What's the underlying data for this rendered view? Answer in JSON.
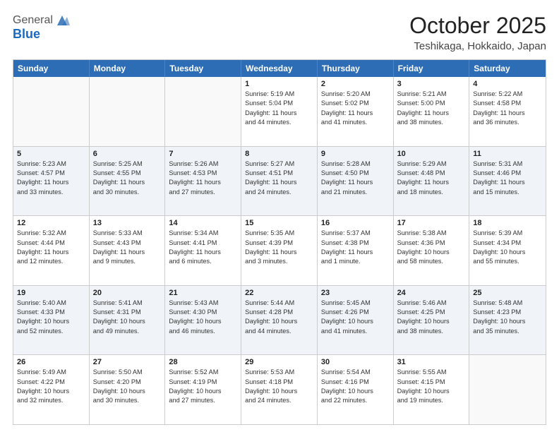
{
  "header": {
    "logo_general": "General",
    "logo_blue": "Blue",
    "month_title": "October 2025",
    "location": "Teshikaga, Hokkaido, Japan"
  },
  "weekdays": [
    "Sunday",
    "Monday",
    "Tuesday",
    "Wednesday",
    "Thursday",
    "Friday",
    "Saturday"
  ],
  "rows": [
    [
      {
        "day": "",
        "info": ""
      },
      {
        "day": "",
        "info": ""
      },
      {
        "day": "",
        "info": ""
      },
      {
        "day": "1",
        "info": "Sunrise: 5:19 AM\nSunset: 5:04 PM\nDaylight: 11 hours\nand 44 minutes."
      },
      {
        "day": "2",
        "info": "Sunrise: 5:20 AM\nSunset: 5:02 PM\nDaylight: 11 hours\nand 41 minutes."
      },
      {
        "day": "3",
        "info": "Sunrise: 5:21 AM\nSunset: 5:00 PM\nDaylight: 11 hours\nand 38 minutes."
      },
      {
        "day": "4",
        "info": "Sunrise: 5:22 AM\nSunset: 4:58 PM\nDaylight: 11 hours\nand 36 minutes."
      }
    ],
    [
      {
        "day": "5",
        "info": "Sunrise: 5:23 AM\nSunset: 4:57 PM\nDaylight: 11 hours\nand 33 minutes."
      },
      {
        "day": "6",
        "info": "Sunrise: 5:25 AM\nSunset: 4:55 PM\nDaylight: 11 hours\nand 30 minutes."
      },
      {
        "day": "7",
        "info": "Sunrise: 5:26 AM\nSunset: 4:53 PM\nDaylight: 11 hours\nand 27 minutes."
      },
      {
        "day": "8",
        "info": "Sunrise: 5:27 AM\nSunset: 4:51 PM\nDaylight: 11 hours\nand 24 minutes."
      },
      {
        "day": "9",
        "info": "Sunrise: 5:28 AM\nSunset: 4:50 PM\nDaylight: 11 hours\nand 21 minutes."
      },
      {
        "day": "10",
        "info": "Sunrise: 5:29 AM\nSunset: 4:48 PM\nDaylight: 11 hours\nand 18 minutes."
      },
      {
        "day": "11",
        "info": "Sunrise: 5:31 AM\nSunset: 4:46 PM\nDaylight: 11 hours\nand 15 minutes."
      }
    ],
    [
      {
        "day": "12",
        "info": "Sunrise: 5:32 AM\nSunset: 4:44 PM\nDaylight: 11 hours\nand 12 minutes."
      },
      {
        "day": "13",
        "info": "Sunrise: 5:33 AM\nSunset: 4:43 PM\nDaylight: 11 hours\nand 9 minutes."
      },
      {
        "day": "14",
        "info": "Sunrise: 5:34 AM\nSunset: 4:41 PM\nDaylight: 11 hours\nand 6 minutes."
      },
      {
        "day": "15",
        "info": "Sunrise: 5:35 AM\nSunset: 4:39 PM\nDaylight: 11 hours\nand 3 minutes."
      },
      {
        "day": "16",
        "info": "Sunrise: 5:37 AM\nSunset: 4:38 PM\nDaylight: 11 hours\nand 1 minute."
      },
      {
        "day": "17",
        "info": "Sunrise: 5:38 AM\nSunset: 4:36 PM\nDaylight: 10 hours\nand 58 minutes."
      },
      {
        "day": "18",
        "info": "Sunrise: 5:39 AM\nSunset: 4:34 PM\nDaylight: 10 hours\nand 55 minutes."
      }
    ],
    [
      {
        "day": "19",
        "info": "Sunrise: 5:40 AM\nSunset: 4:33 PM\nDaylight: 10 hours\nand 52 minutes."
      },
      {
        "day": "20",
        "info": "Sunrise: 5:41 AM\nSunset: 4:31 PM\nDaylight: 10 hours\nand 49 minutes."
      },
      {
        "day": "21",
        "info": "Sunrise: 5:43 AM\nSunset: 4:30 PM\nDaylight: 10 hours\nand 46 minutes."
      },
      {
        "day": "22",
        "info": "Sunrise: 5:44 AM\nSunset: 4:28 PM\nDaylight: 10 hours\nand 44 minutes."
      },
      {
        "day": "23",
        "info": "Sunrise: 5:45 AM\nSunset: 4:26 PM\nDaylight: 10 hours\nand 41 minutes."
      },
      {
        "day": "24",
        "info": "Sunrise: 5:46 AM\nSunset: 4:25 PM\nDaylight: 10 hours\nand 38 minutes."
      },
      {
        "day": "25",
        "info": "Sunrise: 5:48 AM\nSunset: 4:23 PM\nDaylight: 10 hours\nand 35 minutes."
      }
    ],
    [
      {
        "day": "26",
        "info": "Sunrise: 5:49 AM\nSunset: 4:22 PM\nDaylight: 10 hours\nand 32 minutes."
      },
      {
        "day": "27",
        "info": "Sunrise: 5:50 AM\nSunset: 4:20 PM\nDaylight: 10 hours\nand 30 minutes."
      },
      {
        "day": "28",
        "info": "Sunrise: 5:52 AM\nSunset: 4:19 PM\nDaylight: 10 hours\nand 27 minutes."
      },
      {
        "day": "29",
        "info": "Sunrise: 5:53 AM\nSunset: 4:18 PM\nDaylight: 10 hours\nand 24 minutes."
      },
      {
        "day": "30",
        "info": "Sunrise: 5:54 AM\nSunset: 4:16 PM\nDaylight: 10 hours\nand 22 minutes."
      },
      {
        "day": "31",
        "info": "Sunrise: 5:55 AM\nSunset: 4:15 PM\nDaylight: 10 hours\nand 19 minutes."
      },
      {
        "day": "",
        "info": ""
      }
    ]
  ],
  "alt_rows": [
    1,
    3
  ]
}
